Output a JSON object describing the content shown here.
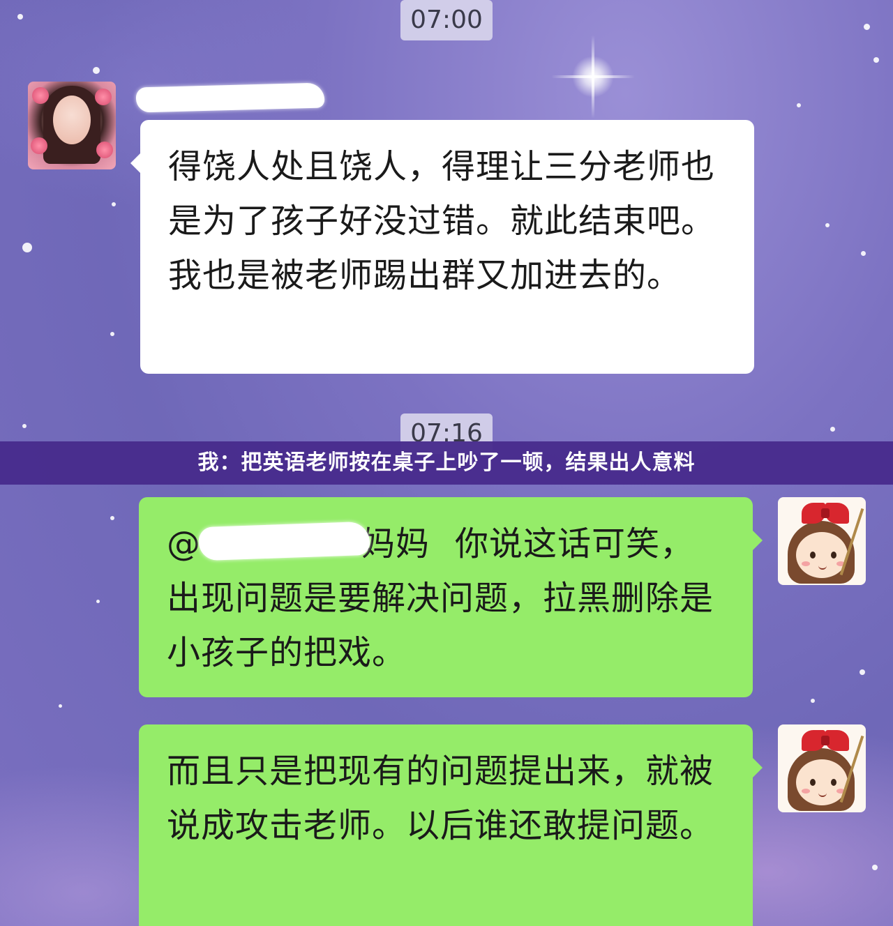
{
  "chat": {
    "timestamps": [
      "07:00",
      "07:16"
    ],
    "messages": [
      {
        "side": "left",
        "text": "得饶人处且饶人，得理让三分老师也是为了孩子好没过错。就此结束吧。我也是被老师踢出群又加进去的。"
      },
      {
        "side": "right",
        "mention_prefix": "@",
        "mention_suffix": "妈妈",
        "text": "你说这话可笑，出现问题是要解决问题，拉黑删除是小孩子的把戏。"
      },
      {
        "side": "right",
        "text": "而且只是把现有的问题提出来，就被说成攻击老师。以后谁还敢提问题。"
      }
    ]
  },
  "caption": "我：把英语老师按在桌子上吵了一顿，结果出人意料",
  "colors": {
    "background": "#7c72c2",
    "left_bubble": "#ffffff",
    "right_bubble": "#95ec69",
    "caption_band": "#482c8c"
  },
  "icons": [
    "contact-avatar-photo",
    "self-avatar-cartoon-girl"
  ]
}
